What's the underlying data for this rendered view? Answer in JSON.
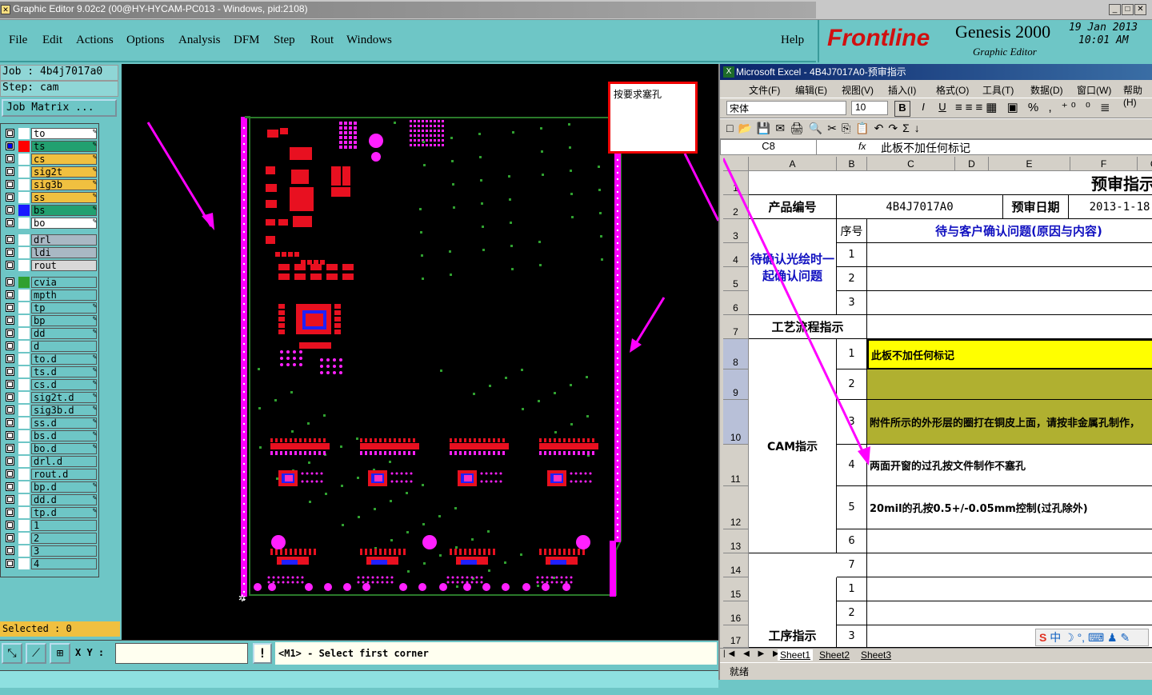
{
  "window": {
    "title": "Graphic Editor 9.02c2 (00@HY-HYCAM-PC013 - Windows, pid:2108)"
  },
  "menu": [
    "File",
    "Edit",
    "Actions",
    "Options",
    "Analysis",
    "DFM",
    "Step",
    "Rout",
    "Windows"
  ],
  "help": "Help",
  "logo": {
    "brand": "Frontline",
    "product": "Genesis 2000",
    "sub": "Graphic Editor",
    "date": "19 Jan 2013",
    "time": "10:01 AM"
  },
  "job": {
    "job_label": "Job : 4b4j7017a0",
    "step_label": "Step: cam",
    "matrix_button": "Job Matrix ..."
  },
  "layers": [
    {
      "name": "to",
      "sw": "#ffffff",
      "bg": "#ffffff",
      "ed": true
    },
    {
      "name": "ts",
      "sw": "#ff0000",
      "bg": "#22a070",
      "ed": true,
      "sel": true
    },
    {
      "name": "cs",
      "sw": "#ffffff",
      "bg": "#f0c040",
      "ed": true
    },
    {
      "name": "sig2t",
      "sw": "#ffffff",
      "bg": "#f0c040",
      "ed": true
    },
    {
      "name": "sig3b",
      "sw": "#ffffff",
      "bg": "#f0c040",
      "ed": true
    },
    {
      "name": "ss",
      "sw": "#ffffff",
      "bg": "#f0c040",
      "ed": true
    },
    {
      "name": "bs",
      "sw": "#1a1aff",
      "bg": "#22a070",
      "ed": true
    },
    {
      "name": "bo",
      "sw": "#ffffff",
      "bg": "#ffffff",
      "ed": true
    },
    {
      "name": "drl",
      "sw": "#ffffff",
      "bg": "#a9b8c4",
      "ed": false
    },
    {
      "name": "ldi",
      "sw": "#ffffff",
      "bg": "#a9b8c4",
      "ed": false
    },
    {
      "name": "rout",
      "sw": "#ffffff",
      "bg": "#d8d8d8",
      "ed": false
    },
    {
      "name": "cvia",
      "sw": "#30a030",
      "bg": "#6ec6c6",
      "ed": false
    },
    {
      "name": "mpth",
      "sw": "#ffffff",
      "bg": "#6ec6c6",
      "ed": false
    },
    {
      "name": "tp",
      "sw": "#ffffff",
      "bg": "#6ec6c6",
      "ed": true
    },
    {
      "name": "bp",
      "sw": "#ffffff",
      "bg": "#6ec6c6",
      "ed": true
    },
    {
      "name": "dd",
      "sw": "#ffffff",
      "bg": "#6ec6c6",
      "ed": true
    },
    {
      "name": "d",
      "sw": "#ffffff",
      "bg": "#6ec6c6",
      "ed": false
    },
    {
      "name": "to.d",
      "sw": "#ffffff",
      "bg": "#6ec6c6",
      "ed": true
    },
    {
      "name": "ts.d",
      "sw": "#ffffff",
      "bg": "#6ec6c6",
      "ed": true
    },
    {
      "name": "cs.d",
      "sw": "#ffffff",
      "bg": "#6ec6c6",
      "ed": true
    },
    {
      "name": "sig2t.d",
      "sw": "#ffffff",
      "bg": "#6ec6c6",
      "ed": true
    },
    {
      "name": "sig3b.d",
      "sw": "#ffffff",
      "bg": "#6ec6c6",
      "ed": true
    },
    {
      "name": "ss.d",
      "sw": "#ffffff",
      "bg": "#6ec6c6",
      "ed": true
    },
    {
      "name": "bs.d",
      "sw": "#ffffff",
      "bg": "#6ec6c6",
      "ed": true
    },
    {
      "name": "bo.d",
      "sw": "#ffffff",
      "bg": "#6ec6c6",
      "ed": true
    },
    {
      "name": "drl.d",
      "sw": "#ffffff",
      "bg": "#6ec6c6",
      "ed": false
    },
    {
      "name": "rout.d",
      "sw": "#ffffff",
      "bg": "#6ec6c6",
      "ed": false
    },
    {
      "name": "bp.d",
      "sw": "#ffffff",
      "bg": "#6ec6c6",
      "ed": true
    },
    {
      "name": "dd.d",
      "sw": "#ffffff",
      "bg": "#6ec6c6",
      "ed": true
    },
    {
      "name": "tp.d",
      "sw": "#ffffff",
      "bg": "#6ec6c6",
      "ed": true
    },
    {
      "name": "1",
      "sw": "#ffffff",
      "bg": "#6ec6c6",
      "ed": false
    },
    {
      "name": "2",
      "sw": "#ffffff",
      "bg": "#6ec6c6",
      "ed": false
    },
    {
      "name": "3",
      "sw": "#ffffff",
      "bg": "#6ec6c6",
      "ed": false
    },
    {
      "name": "4",
      "sw": "#ffffff",
      "bg": "#6ec6c6",
      "ed": false
    }
  ],
  "selected": "Selected : 0",
  "coord": {
    "label": "X Y :",
    "value": ""
  },
  "prompt": "<M1> - Select first corner",
  "annotation": "按要求塞孔",
  "excel": {
    "title": "Microsoft Excel - 4B4J7017A0-预审指示",
    "menu": [
      "文件(F)",
      "编辑(E)",
      "视图(V)",
      "插入(I)",
      "格式(O)",
      "工具(T)",
      "数据(D)",
      "窗口(W)",
      "帮助(H)"
    ],
    "font": "宋体",
    "size": "10",
    "namebox": "C8",
    "fx": "fx",
    "formula": "此板不加任何标记",
    "cols": [
      "A",
      "B",
      "C",
      "D",
      "E",
      "F",
      "G"
    ],
    "rows": [
      "1",
      "2",
      "3",
      "4",
      "5",
      "6",
      "7",
      "8",
      "9",
      "10",
      "11",
      "12",
      "13",
      "14",
      "15",
      "16",
      "17"
    ],
    "title_cell": "预审指示",
    "product_label": "产品编号",
    "product_value": "4B4J7017A0",
    "date_label": "预审日期",
    "date_value": "2013-1-18",
    "seq_label": "序号",
    "issue_header": "待与客户确认问题(原因与内容)",
    "confirm_label": "待确认光绘时一起确认问题",
    "process_label": "工艺流程指示",
    "cam_label": "CAM指示",
    "step_label": "工序指示",
    "seq": [
      "1",
      "2",
      "3",
      "1",
      "2",
      "3",
      "4",
      "5",
      "6",
      "7",
      "1",
      "2",
      "3"
    ],
    "cam_items": [
      "此板不加任何标记",
      "",
      "附件所示的外形层的圈打在铜皮上面，请按非金属孔制作，",
      "两面开窗的过孔按文件制作不塞孔",
      "20mil的孔按0.5+/-0.05mm控制(过孔除外)"
    ],
    "sheets": [
      "Sheet1",
      "Sheet2",
      "Sheet3"
    ],
    "status": "就绪",
    "ime": "中"
  },
  "colors": {
    "teal": "#6ec6c6",
    "magenta": "#ff00ff",
    "red": "#ff0000",
    "yellow": "#ffff00",
    "olive": "#b0b030"
  }
}
